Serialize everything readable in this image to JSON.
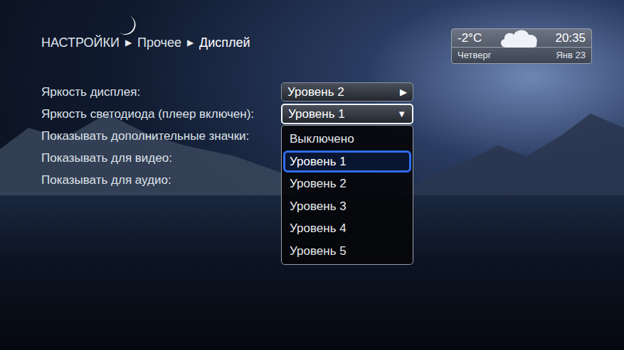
{
  "breadcrumb": {
    "items": [
      {
        "label": "НАСТРОЙКИ"
      },
      {
        "label": "Прочее"
      },
      {
        "label": "Дисплей"
      }
    ],
    "separator": "▶"
  },
  "weather": {
    "temperature": "-2°C",
    "time": "20:35",
    "day": "Четверг",
    "date": "Янв 23"
  },
  "settings": [
    {
      "label": "Яркость дисплея:",
      "kind": "select",
      "value": "Уровень 2",
      "arrow": "▶",
      "focused": false
    },
    {
      "label": "Яркость светодиода (плеер включен):",
      "kind": "select",
      "value": "Уровень 1",
      "arrow": "▼",
      "focused": true
    },
    {
      "label": "Показывать дополнительные значки:",
      "kind": "covered"
    },
    {
      "label": "Показывать для видео:",
      "kind": "covered"
    },
    {
      "label": "Показывать для аудио:",
      "kind": "covered"
    }
  ],
  "dropdown": {
    "options": [
      {
        "label": "Выключено",
        "selected": false
      },
      {
        "label": "Уровень 1",
        "selected": true
      },
      {
        "label": "Уровень 2",
        "selected": false
      },
      {
        "label": "Уровень 3",
        "selected": false
      },
      {
        "label": "Уровень 4",
        "selected": false
      },
      {
        "label": "Уровень 5",
        "selected": false
      }
    ]
  }
}
